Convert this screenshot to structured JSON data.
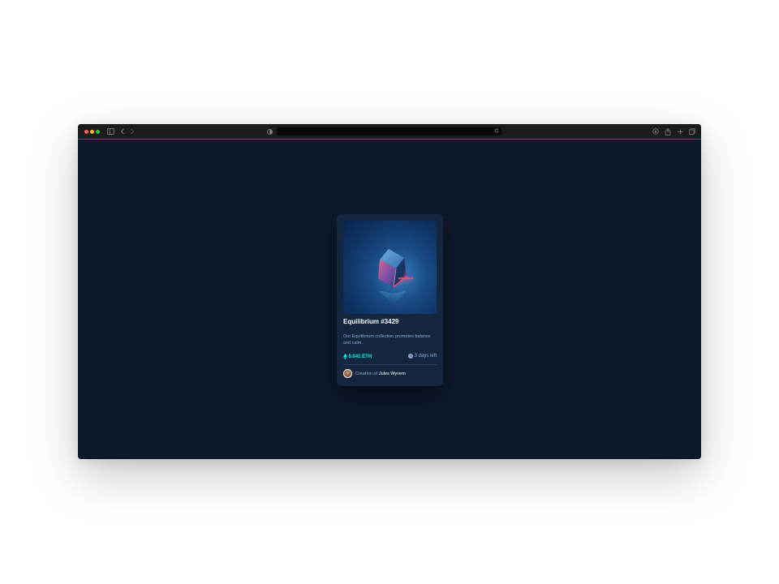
{
  "browser": {
    "traffic_colors": {
      "close": "#ff5f57",
      "minimize": "#febc2e",
      "zoom": "#28c840"
    },
    "icons": [
      "sidebar-icon",
      "back-icon",
      "forward-icon",
      "shield-icon",
      "reload-icon",
      "download-icon",
      "share-icon",
      "new-tab-icon",
      "tab-overview-icon"
    ]
  },
  "card": {
    "title": "Equilibrium #3429",
    "description": "Our Equilibrium collection promotes balance and calm.",
    "price": "0.041 ETH",
    "time_left": "3 days left",
    "creator_prefix": "Creation of",
    "creator_name": "Jules Wyvern",
    "colors": {
      "page_bg": "#0d1829",
      "card_bg": "#15263f",
      "accent": "#00fff8",
      "muted": "#8bacd9",
      "line": "#2e405a"
    }
  }
}
